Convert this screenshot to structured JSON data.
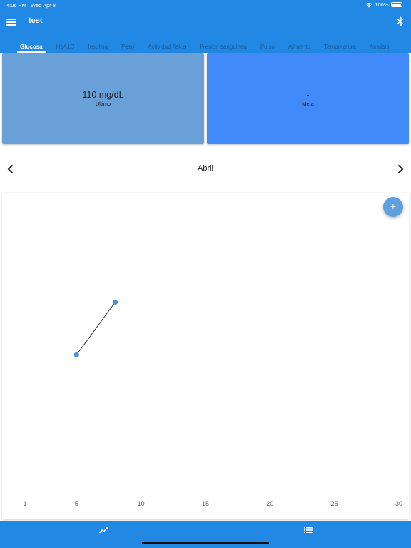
{
  "status": {
    "time": "4:06 PM",
    "date": "Wed Apr 8",
    "battery": "100%"
  },
  "app": {
    "title": "test"
  },
  "tabs": [
    {
      "label": "Glucosa",
      "active": true
    },
    {
      "label": "HbA1C",
      "active": false
    },
    {
      "label": "Insulina",
      "active": false
    },
    {
      "label": "Peso",
      "active": false
    },
    {
      "label": "Actividad física",
      "active": false
    },
    {
      "label": "Presion sanguinea",
      "active": false
    },
    {
      "label": "Pulso",
      "active": false
    },
    {
      "label": "Alimento",
      "active": false
    },
    {
      "label": "Temperatura",
      "active": false
    },
    {
      "label": "Analisis",
      "active": false
    }
  ],
  "cards": {
    "last_value": "110 mg/dL",
    "last_label": "Ultimo",
    "goal_value": "-",
    "goal_label": "Meta"
  },
  "month": {
    "label": "Abril"
  },
  "fab": {
    "label": "+"
  },
  "colors": {
    "primary": "#2189e4",
    "point": "#4a8fd8",
    "line": "#222222"
  },
  "chart_data": {
    "type": "line",
    "x_ticks": [
      1,
      5,
      10,
      15,
      20,
      25,
      30
    ],
    "xlim": [
      1,
      30
    ],
    "ylim": [
      0,
      1
    ],
    "points": [
      {
        "x": 5,
        "y": 0.47
      },
      {
        "x": 8,
        "y": 0.65
      }
    ]
  }
}
